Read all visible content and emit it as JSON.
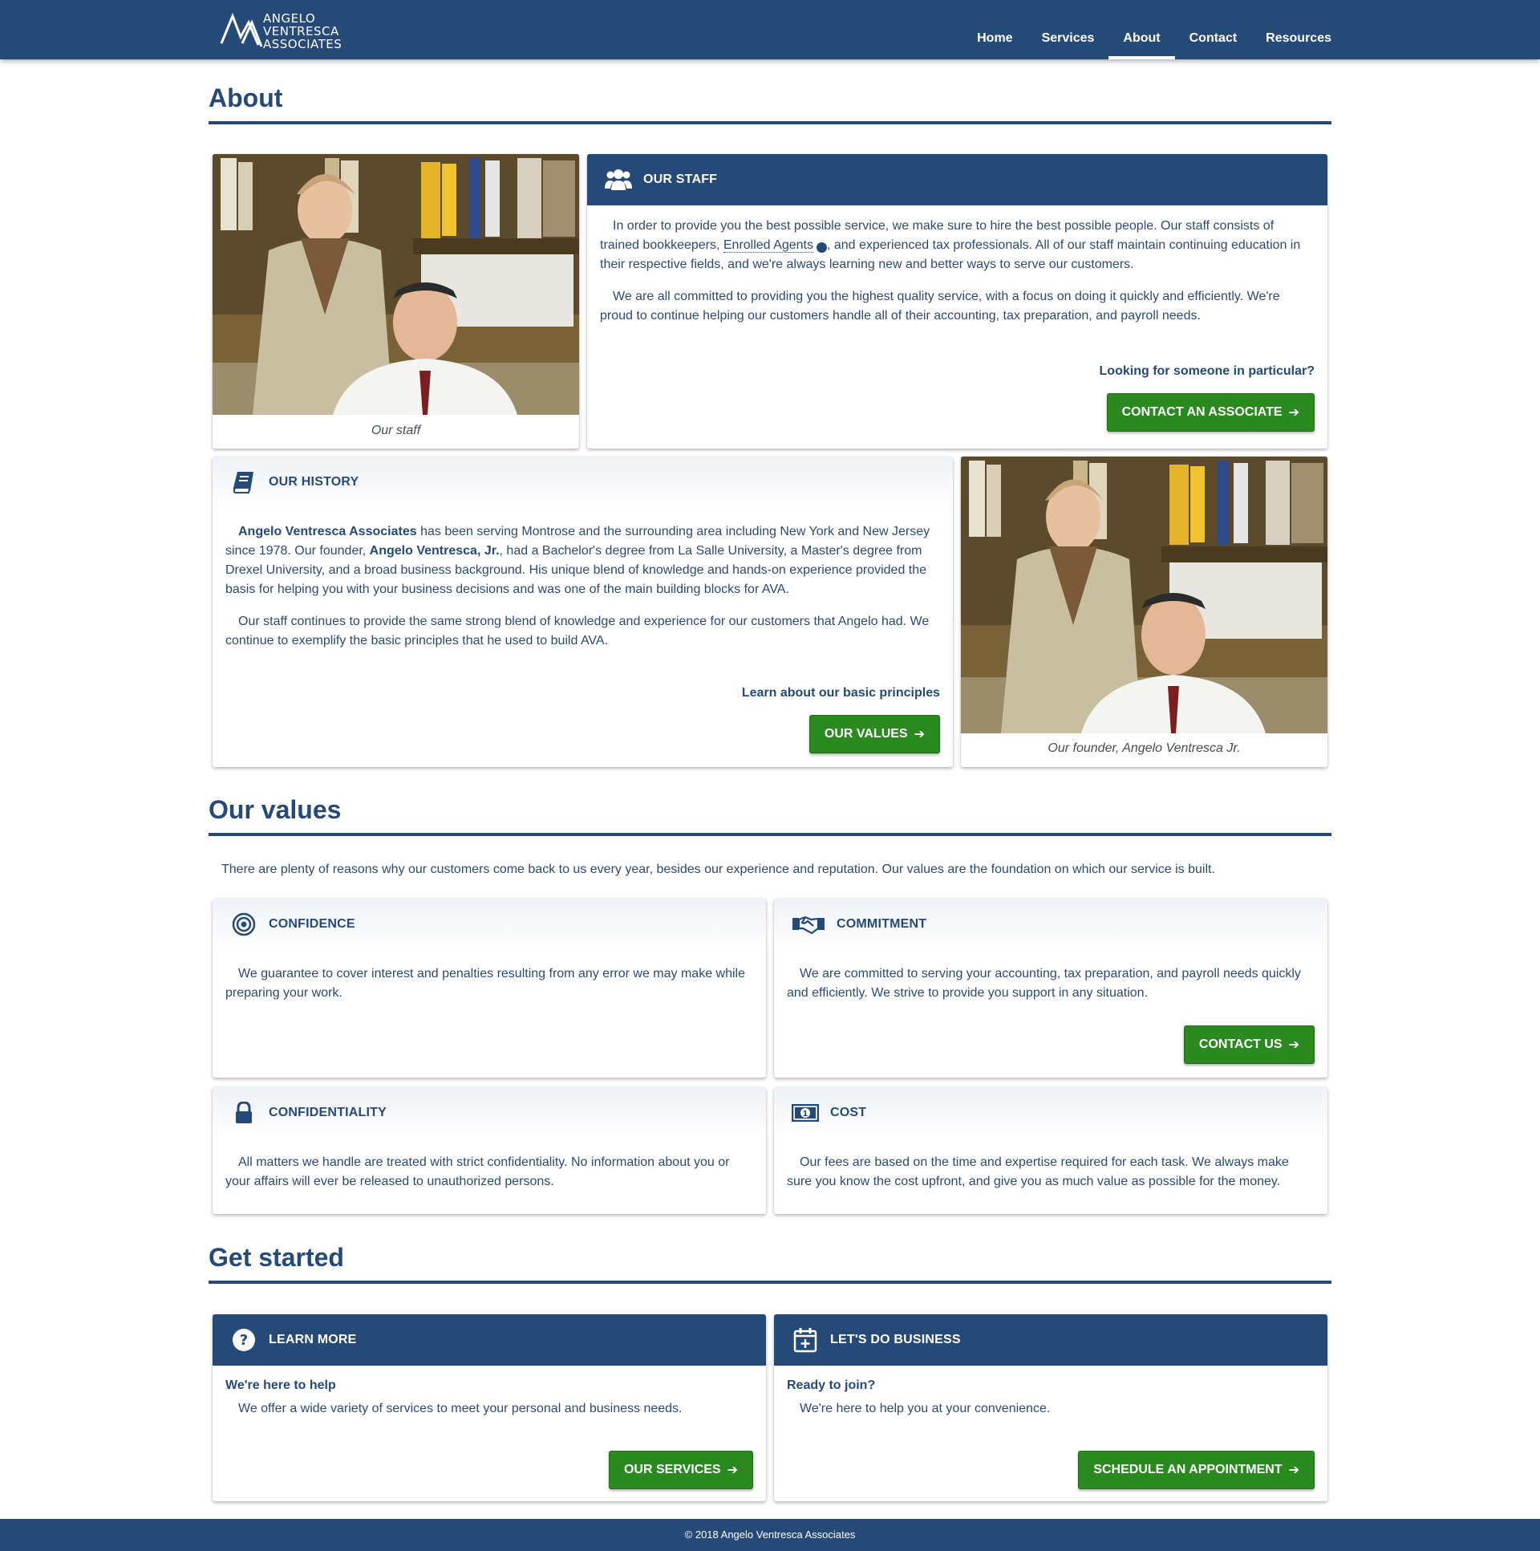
{
  "header": {
    "logo_lines": [
      "ANGELO",
      "VENTRESCA",
      "ASSOCIATES"
    ],
    "nav": [
      "Home",
      "Services",
      "About",
      "Contact",
      "Resources"
    ],
    "active_nav": "About"
  },
  "about": {
    "title": "About",
    "staff_photo_caption": "Our staff",
    "staff": {
      "title": "OUR STAFF",
      "p1_before": "In order to provide you the best possible service, we make sure to hire the best possible people. Our staff consists of trained bookkeepers, ",
      "p1_link": "Enrolled Agents",
      "p1_after": ", and experienced tax professionals. All of our staff maintain continuing education in their respective fields, and we're always learning new and better ways to serve our customers.",
      "p2": "We are all committed to providing you the highest quality service, with a focus on doing it quickly and efficiently. We're proud to continue helping our customers handle all of their accounting, tax preparation, and payroll needs.",
      "prompt": "Looking for someone in particular?",
      "button": "CONTACT AN ASSOCIATE"
    },
    "history": {
      "title": "OUR HISTORY",
      "p1_bold1": "Angelo Ventresca Associates",
      "p1_mid": " has been serving Montrose and the surrounding area including New York and New Jersey since 1978. Our founder, ",
      "p1_bold2": "Angelo Ventresca, Jr.",
      "p1_after": ", had a Bachelor's degree from La Salle University, a Master's degree from Drexel University, and a broad business background. His unique blend of knowledge and hands-on experience provided the basis for helping you with your business decisions and was one of the main building blocks for AVA.",
      "p2": "Our staff continues to provide the same strong blend of knowledge and experience for our customers that Angelo had. We continue to exemplify the basic principles that he used to build AVA.",
      "prompt": "Learn about our basic principles",
      "button": "OUR VALUES"
    },
    "founder_photo_caption": "Our founder, Angelo Ventresca Jr."
  },
  "values": {
    "title": "Our values",
    "intro": "There are plenty of reasons why our customers come back to us every year, besides our experience and reputation. Our values are the foundation on which our service is built.",
    "confidence": {
      "title": "CONFIDENCE",
      "text": "We guarantee to cover interest and penalties resulting from any error we may make while preparing your work."
    },
    "commitment": {
      "title": "COMMITMENT",
      "text": "We are committed to serving your accounting, tax preparation, and payroll needs quickly and efficiently. We strive to provide you support in any situation.",
      "button": "CONTACT US"
    },
    "confidentiality": {
      "title": "CONFIDENTIALITY",
      "text": "All matters we handle are treated with strict confidentiality. No information about you or your affairs will ever be released to unauthorized persons."
    },
    "cost": {
      "title": "COST",
      "text": "Our fees are based on the time and expertise required for each task. We always make sure you know the cost upfront, and give you as much value as possible for the money."
    }
  },
  "get_started": {
    "title": "Get started",
    "learn": {
      "title": "LEARN MORE",
      "subtitle": "We're here to help",
      "text": "We offer a wide variety of services to meet your personal and business needs.",
      "button": "OUR SERVICES"
    },
    "business": {
      "title": "LET'S DO BUSINESS",
      "subtitle": "Ready to join?",
      "text": "We're here to help you at your convenience.",
      "button": "SCHEDULE AN APPOINTMENT"
    }
  },
  "footer": {
    "text": "© 2018 Angelo Ventresca Associates"
  },
  "icons": {
    "staff": "users-icon",
    "history": "book-icon",
    "confidence": "bullseye-icon",
    "commitment": "handshake-icon",
    "confidentiality": "lock-icon",
    "cost": "money-bill-icon",
    "learn": "question-circle-icon",
    "business": "calendar-plus-icon",
    "arrow": "arrow-right-icon",
    "info": "info-circle-icon"
  },
  "colors": {
    "brand_navy": "#264a78",
    "button_green": "#2a8a1f",
    "text": "#2c4a72"
  }
}
